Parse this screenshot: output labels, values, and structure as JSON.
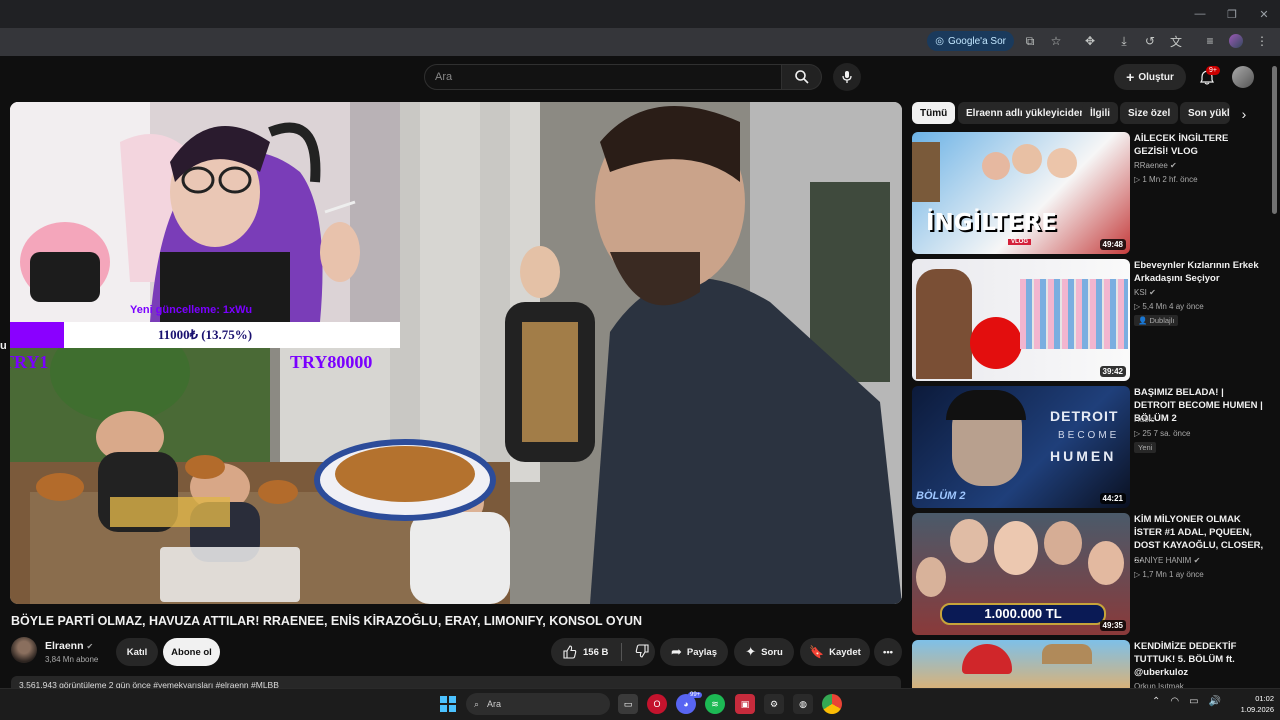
{
  "browser": {
    "google_sor": "Google'a Sor",
    "window_controls": [
      "—",
      "❐",
      "✕"
    ]
  },
  "header": {
    "search_placeholder": "Ara",
    "create_label": "Oluştur",
    "notif_count": "9+"
  },
  "overlay": {
    "donation_text": "Yeni güncelleme: 1xWu",
    "donation_amount": "11000₺ (13.75%)",
    "donation_progress": 0.1375,
    "try_left": "TRY1",
    "try_right": "TRY80000",
    "side_letter": "u"
  },
  "chips": [
    "Tümü",
    "Elraenn adlı yükleyiciden",
    "İlgili",
    "Size özel",
    "Son yükl"
  ],
  "videos": [
    {
      "title": "AİLECEK İNGİLTERE GEZİSİ! VLOG",
      "channel": "RRaenee",
      "meta": "▷ 1 Mn  2 hf. önce",
      "duration": "49:48",
      "badge": ""
    },
    {
      "title": "Ebeveynler Kızlarının Erkek Arkadaşını Seçiyor",
      "channel": "KSI",
      "meta": "▷ 5,4 Mn  4 ay önce",
      "duration": "39:42",
      "badge": "Dublajlı"
    },
    {
      "title": "BAŞIMIZ BELADA! | DETROIT BECOME HUMEN | BÖLÜM 2",
      "channel": "Hübic",
      "meta": "▷ 25  7 sa. önce",
      "duration": "44:21",
      "badge": "Yeni"
    },
    {
      "title": "KİM MİLYONER OLMAK İSTER #1 ADAL, PQUEEN, DOST KAYAOĞLU, CLOSER, ...",
      "channel": "SANİYE HANIM",
      "meta": "▷ 1,7 Mn  1 ay önce",
      "duration": "49:35",
      "badge": ""
    },
    {
      "title": "KENDİMİZE DEDEKTİF TUTTUK! 5. BÖLÜM ft. @uberkuloz",
      "channel": "Orkun Işıtmak",
      "meta": "",
      "duration": "",
      "badge": ""
    }
  ],
  "thumb_text": {
    "ingiltere": "İNGİLTERE",
    "vlog": "VLOG",
    "detroit": [
      "DETROIT",
      "BECOME",
      "HUMEN"
    ],
    "bolum": "BÖLÜM 2",
    "milyoner": "1.000.000 TL"
  },
  "video": {
    "title": "BÖYLE PARTİ OLMAZ, HAVUZA ATTILAR! RRAENEE, ENİS KİRAZOĞLU, ERAY, LIMONIFY, KONSOL OYUN",
    "channel": "Elraenn",
    "subs": "3,84 Mn abone",
    "join": "Katıl",
    "subscribe": "Abone ol",
    "likes": "156 B",
    "share": "Paylaş",
    "ask": "Soru",
    "save": "Kaydet",
    "more": "•••",
    "desc": "3.561.943 görüntüleme  2 gün önce  #yemekyarışları #elraenn #MLBB"
  },
  "taskbar": {
    "search": "Ara",
    "time": "01:02",
    "date": "1.09.2026",
    "discord_badge": "99+"
  },
  "colors": {
    "bg": "#0f0f0f",
    "chip": "#272727",
    "accent_purple": "#8a00ff",
    "youtube_red": "#cc0000"
  }
}
